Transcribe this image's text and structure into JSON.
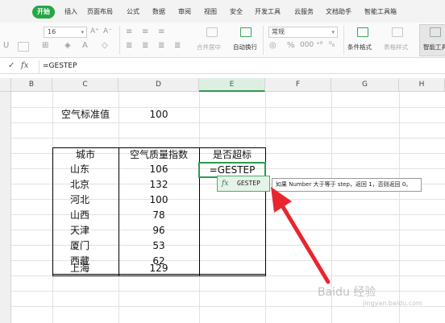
{
  "ribbon": {
    "tabs": [
      {
        "label": "开始",
        "active": true
      },
      {
        "label": "插入"
      },
      {
        "label": "页面布局"
      },
      {
        "label": "公式"
      },
      {
        "label": "数据"
      },
      {
        "label": "审阅"
      },
      {
        "label": "视图"
      },
      {
        "label": "安全"
      },
      {
        "label": "开发工具"
      },
      {
        "label": "云服务"
      },
      {
        "label": "文档助手"
      },
      {
        "label": "智能工具箱"
      }
    ]
  },
  "toolbar": {
    "font_size": "16",
    "grow_font": "A⁺",
    "shrink_font": "A⁻",
    "number_format": "常规",
    "merge_center": "合并居中",
    "wrap_text": "自动换行",
    "conditional_format": "条件格式",
    "table_style": "表格样式",
    "smart_tools": "智能工具"
  },
  "formula_bar": {
    "check": "✓",
    "fx": "fx",
    "content": "=GESTEP"
  },
  "columns": [
    "B",
    "C",
    "D",
    "E",
    "F",
    "G",
    "H"
  ],
  "sheet": {
    "std_label": "空气标准值",
    "std_value": "100",
    "headers": [
      "城市",
      "空气质量指数",
      "是否超标"
    ],
    "rows": [
      {
        "city": "山东",
        "aqi": "106"
      },
      {
        "city": "北京",
        "aqi": "132"
      },
      {
        "city": "河北",
        "aqi": "100"
      },
      {
        "city": "山西",
        "aqi": "78"
      },
      {
        "city": "天津",
        "aqi": "96"
      },
      {
        "city": "厦门",
        "aqi": "53"
      },
      {
        "city": "西藏",
        "aqi": "62"
      },
      {
        "city": "上海",
        "aqi": "129"
      }
    ],
    "editing_cell_text": "=GESTEP"
  },
  "autocomplete": {
    "icon": "fx",
    "function_name": "GESTEP",
    "tooltip": "如果 Number 大于等于 step，返回 1，否则返回 0。"
  },
  "watermark": {
    "main": "Baidu 经验",
    "sub": "jingyan.baidu.com"
  },
  "colors": {
    "accent": "#27a744",
    "selection": "#2d9a4d",
    "arrow": "#e8262e"
  }
}
